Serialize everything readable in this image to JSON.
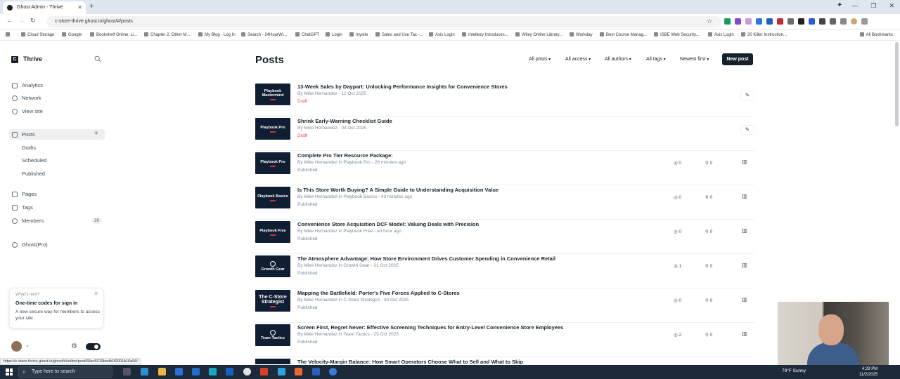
{
  "browser": {
    "tab_title": "Ghost Admin - Thrive",
    "url": "c-store-thrive.ghost.io/ghost/#/posts",
    "bookmarks": [
      "Cloud Storage",
      "Google",
      "Bookshelf Online: Li...",
      "Chapter 2. Other M...",
      "My Blog - Log In",
      "Search - 24HourWi...",
      "ChatGPT",
      "Login",
      "mysite",
      "Sales and Use Tax -...",
      "Axis Login",
      "Intellezy Introduces...",
      "Wiley Online Library...",
      "Workday",
      "Best Course Manag...",
      "ISBE Web Security...",
      "Axis Login",
      "20 Killer Instruction..."
    ],
    "all_bookmarks": "All Bookmarks",
    "status_url": "https://c-store-thrive.ghost.io/ghost/#/editor/post/68ec5019bedb1f0001b16a96/"
  },
  "sidebar": {
    "site_name": "Thrive",
    "logo_letter": "C",
    "nav": [
      {
        "label": "Analytics"
      },
      {
        "label": "Network"
      },
      {
        "label": "View site"
      }
    ],
    "posts_label": "Posts",
    "posts_sub": [
      {
        "label": "Drafts"
      },
      {
        "label": "Scheduled"
      },
      {
        "label": "Published"
      }
    ],
    "nav2": [
      {
        "label": "Pages"
      },
      {
        "label": "Tags"
      },
      {
        "label": "Members"
      }
    ],
    "members_count": "20",
    "ghost_pro": "Ghost(Pro)",
    "whats_new": {
      "tag": "What's new?",
      "title": "One-time codes for sign in",
      "body": "A new secure way for members to access your site"
    }
  },
  "header": {
    "title": "Posts",
    "filters": [
      "All posts",
      "All access",
      "All authors",
      "All tags",
      "Newest first"
    ],
    "new_post": "New post"
  },
  "posts": [
    {
      "title": "13-Week Sales by Daypart: Unlocking Performance Insights for Convenience Stores",
      "meta": "By Mike Hernandez - 12 Oct 2025",
      "status": "Draft",
      "thumb": "Playbook Mastermind",
      "thumb_sub": "",
      "kind": "draft"
    },
    {
      "title": "Shrink Early-Warning Checklist Guide",
      "meta": "By Mike Hernandez - 04 Oct 2025",
      "status": "Draft",
      "thumb": "Playbook Pro",
      "thumb_sub": "",
      "kind": "draft"
    },
    {
      "title": "Complete Pro Tier Resource Package:",
      "meta": "By Mike Hernandez in Playbook Pro - 28 minutes ago",
      "status": "Published",
      "thumb": "Playbook Pro",
      "thumb_sub": "",
      "views": "0",
      "members": "0",
      "kind": "pub"
    },
    {
      "title": "Is This Store Worth Buying? A Simple Guide to Understanding Acquisition Value",
      "meta": "By Mike Hernandez in Playbook Basics - 43 minutes ago",
      "status": "Published",
      "thumb": "Playbook Basics",
      "thumb_sub": "",
      "views": "0",
      "members": "0",
      "kind": "pub"
    },
    {
      "title": "Convenience Store Acquisition DCF Model: Valuing Deals with Precision",
      "meta": "By Mike Hernandez in Playbook Free - an hour ago",
      "status": "Published",
      "thumb": "Playbook Free",
      "thumb_sub": "",
      "views": "0",
      "members": "0",
      "kind": "pub"
    },
    {
      "title": "The Atmosphere Advantage: How Store Environment Drives Customer Spending in Convenience Retail",
      "meta": "By Mike Hernandez in Growth Gear - 31 Oct 2025",
      "status": "Published",
      "thumb": "Growth Gear",
      "thumb_sub": "",
      "views": "1",
      "members": "0",
      "kind": "pub"
    },
    {
      "title": "Mapping the Battlefield: Porter's Five Forces Applied to C-Stores",
      "meta": "By Mike Hernandez in C-Store Strategist - 30 Oct 2025",
      "status": "Published",
      "thumb": "The C-Store Strategist",
      "thumb_sub": "",
      "views": "0",
      "members": "0",
      "kind": "pub"
    },
    {
      "title": "Screen First, Regret Never: Effective Screening Techniques for Entry-Level Convenience Store Employees",
      "meta": "By Mike Hernandez in Team Tactics - 29 Oct 2025",
      "status": "Published",
      "thumb": "Team Tactics",
      "thumb_sub": "",
      "views": "2",
      "members": "0",
      "kind": "pub"
    },
    {
      "title": "The Velocity-Margin Balance: How Smart Operators Choose What to Sell and What to Skip",
      "meta": "",
      "status": "",
      "thumb": "",
      "thumb_sub": "",
      "kind": "partial"
    }
  ],
  "taskbar": {
    "search_placeholder": "Type here to search",
    "weather": "79°F  Sunny",
    "time": "4:28 PM",
    "date": "11/2/2025"
  },
  "colors": {
    "ink": "#15212a",
    "draft": "#e5484d",
    "thumb_bg": "#0f1e33"
  }
}
